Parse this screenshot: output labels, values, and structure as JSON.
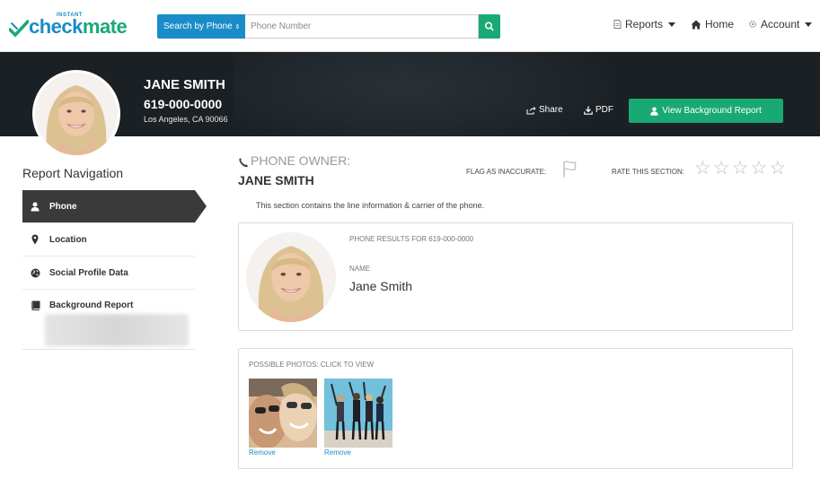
{
  "header": {
    "logo_small": "INSTANT",
    "logo_part1": "check",
    "logo_part2": "mate",
    "search_select": "Search by Phone",
    "search_placeholder": "Phone Number",
    "nav": {
      "reports": "Reports",
      "home": "Home",
      "account": "Account"
    }
  },
  "profile": {
    "name": "JANE SMITH",
    "phone": "619-000-0000",
    "location": "Los Angeles, CA 90066",
    "share_label": "Share",
    "pdf_label": "PDF",
    "view_report_label": "View Background Report"
  },
  "sidebar": {
    "title": "Report Navigation",
    "items": [
      {
        "label": "Phone",
        "icon": "user-icon",
        "active": true
      },
      {
        "label": "Location",
        "icon": "map-pin-icon",
        "active": false
      },
      {
        "label": "Social Profile Data",
        "icon": "globe-icon",
        "active": false
      },
      {
        "label": "Background Report",
        "icon": "book-icon",
        "active": false
      }
    ]
  },
  "main": {
    "owner_label": "PHONE OWNER:",
    "owner_name": "JANE SMITH",
    "flag_label": "FLAG AS INACCURATE:",
    "rate_label": "RATE THIS SECTION:",
    "rating": 0,
    "rating_max": 5,
    "section_desc": "This section contains the line information & carrier of the phone.",
    "results_label": "PHONE RESULTS FOR 619-000-0000",
    "name_label": "NAME",
    "name_value": "Jane Smith",
    "photos_label": "POSSIBLE PHOTOS: CLICK TO VIEW",
    "remove_label": "Remove"
  },
  "colors": {
    "blue": "#1a8cc7",
    "green": "#19a974",
    "dark": "#1b2024"
  }
}
